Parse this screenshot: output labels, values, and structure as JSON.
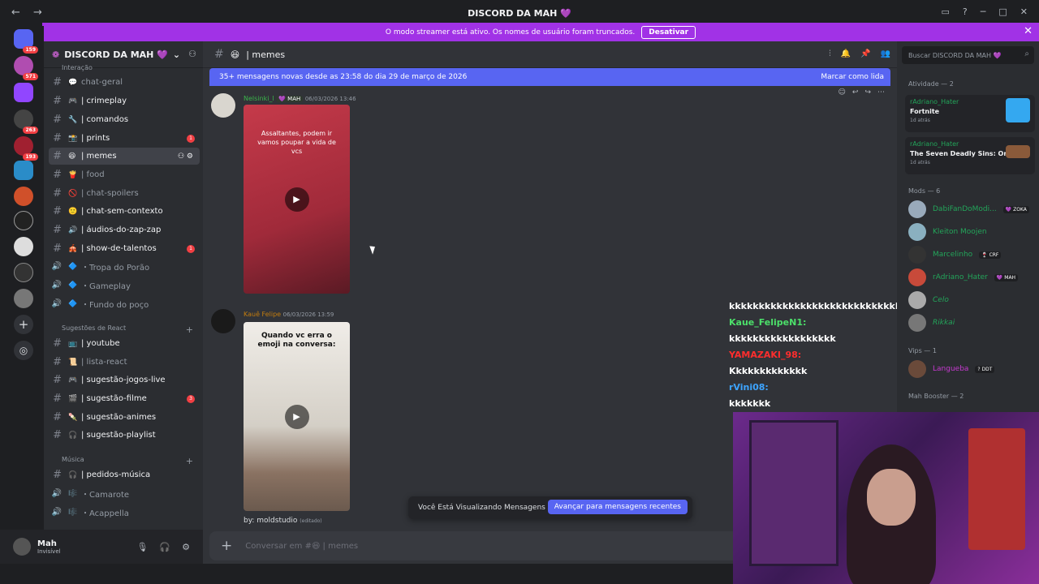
{
  "window": {
    "title": "DISCORD DA MAH 💜"
  },
  "banner": {
    "text": "O modo streamer está ativo. Os nomes de usuário foram truncados.",
    "button": "Desativar"
  },
  "guild_badges": [
    "159",
    "571",
    "263",
    "193"
  ],
  "server": {
    "name": "DISCORD DA MAH 💜"
  },
  "categories": {
    "interacao": "Interação",
    "react": "Sugestões de React",
    "musica": "Música"
  },
  "channels": [
    {
      "label": "chat-geral",
      "emoji": "💬"
    },
    {
      "label": "| crimeplay",
      "emoji": "🎮"
    },
    {
      "label": "| comandos",
      "emoji": "🔧"
    },
    {
      "label": "| prints",
      "emoji": "📸",
      "badge": "1"
    },
    {
      "label": "| memes",
      "emoji": "😆"
    },
    {
      "label": "| food",
      "emoji": "🍟"
    },
    {
      "label": "| chat-spoilers",
      "emoji": "🚫"
    },
    {
      "label": "| chat-sem-contexto",
      "emoji": "🙂"
    },
    {
      "label": "| áudios-do-zap-zap",
      "emoji": "🔊"
    },
    {
      "label": "| show-de-talentos",
      "emoji": "🎪",
      "badge": "1"
    },
    {
      "label": "・Tropa do Porão",
      "emoji": "🔷"
    },
    {
      "label": "・Gameplay",
      "emoji": "🔷"
    },
    {
      "label": "・Fundo do poço",
      "emoji": "🔷"
    },
    {
      "label": "| youtube",
      "emoji": "📺"
    },
    {
      "label": "| lista-react",
      "emoji": "📜"
    },
    {
      "label": "| sugestão-jogos-live",
      "emoji": "🎮"
    },
    {
      "label": "| sugestão-filme",
      "emoji": "🎬",
      "badge": "3"
    },
    {
      "label": "| sugestão-animes",
      "emoji": "🍡"
    },
    {
      "label": "| sugestão-playlist",
      "emoji": "🎧"
    },
    {
      "label": "| pedidos-música",
      "emoji": "🎧"
    },
    {
      "label": "・Camarote",
      "emoji": "🎼"
    },
    {
      "label": "・Acappella",
      "emoji": "🎼"
    }
  ],
  "user": {
    "name": "Mah",
    "status": "Invisível"
  },
  "channel_header": {
    "name": "| memes",
    "emoji": "😆"
  },
  "newbar": {
    "text": "35+ mensagens novas desde as 23:58 do dia 29 de março de 2026",
    "mark": "Marcar como lida"
  },
  "messages": [
    {
      "author": "Nelsinki_l",
      "tag": "💜 MAH",
      "time": "06/03/2026 13:46",
      "video_text": "Assaltantes, podem ir vamos poupar a vida de vcs"
    },
    {
      "author": "Kauê Felipe",
      "time": "06/03/2026 13:59",
      "video_text": "Quando vc erra o emoji na conversa:",
      "caption": "by: moldstudio",
      "edited": "(editado)"
    }
  ],
  "old_messages": {
    "text": "Você Está Visualizando Mensagens Antigas",
    "button": "Avançar para mensagens recentes"
  },
  "composer": {
    "placeholder": "Conversar em #😆 | memes"
  },
  "stream_chat": [
    {
      "name": "",
      "text": "kkkkkkkkkkkkkkkkkkkkkkkkkkkkkkkkk",
      "color": "#ffffff"
    },
    {
      "name": "Kaue_FelipeN1:",
      "text": "kkkkkkkkkkkkkkkkkk",
      "color": "#4ce06a"
    },
    {
      "name": "YAMAZAKI_98:",
      "text": "Kkkkkkkkkkkkk",
      "color": "#ff2d2d"
    },
    {
      "name": "rVini08:",
      "text": "kkkkkkk",
      "color": "#3da4ff"
    }
  ],
  "members": {
    "search": "Buscar DISCORD DA MAH 💜",
    "activity_header": "Atividade — 2",
    "activities": [
      {
        "user": "rAdriano_Hater",
        "game": "Fortnite",
        "time": "1d atrás"
      },
      {
        "user": "rAdriano_Hater",
        "game": "The Seven Deadly Sins: Ori...",
        "time": "1d atrás"
      }
    ],
    "mods_header": "Mods — 6",
    "mods": [
      {
        "name": "DabiFanDoModi...",
        "tag": "💜 ZOKA",
        "color": "#23a55a"
      },
      {
        "name": "Kleiton Moojen",
        "tag": "",
        "color": "#23a55a"
      },
      {
        "name": "Marcelinho",
        "tag": "🍷 CRF",
        "color": "#23a55a"
      },
      {
        "name": "rAdriano_Hater",
        "tag": "💜 MAH",
        "color": "#23a55a"
      },
      {
        "name": "Celo",
        "tag": "",
        "color": "#23a55a"
      },
      {
        "name": "Rikkai",
        "tag": "",
        "color": "#23a55a"
      }
    ],
    "vips_header": "Vips — 1",
    "vips": [
      {
        "name": "Langueba",
        "tag": "? DDT",
        "color": "#c63ad0"
      }
    ],
    "booster_header": "Mah Booster — 2"
  }
}
